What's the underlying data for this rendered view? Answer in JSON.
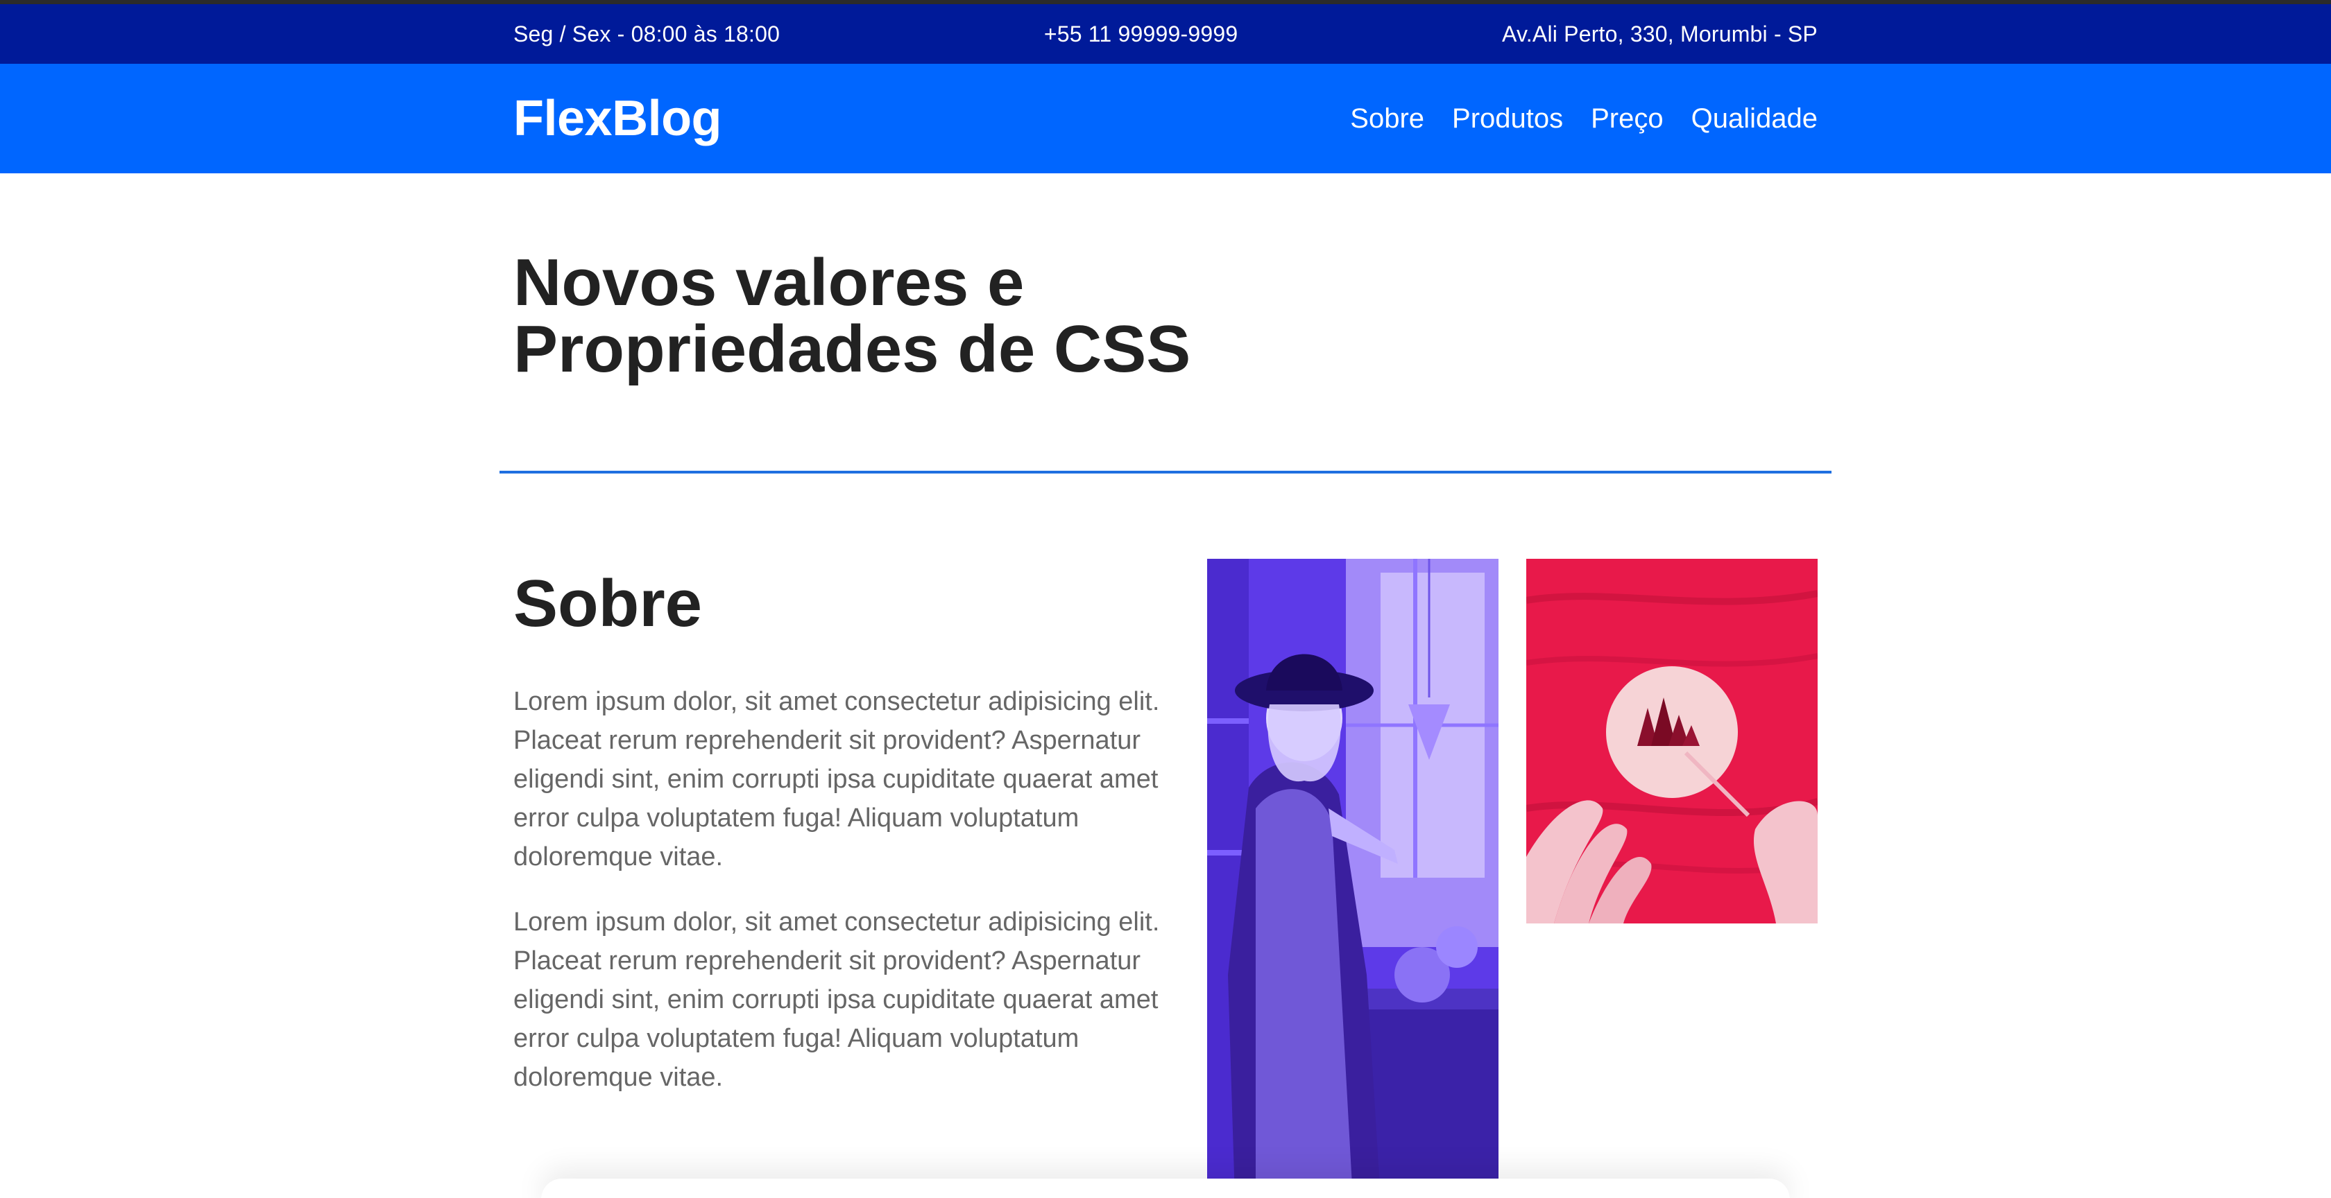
{
  "info_bar": {
    "hours": "Seg / Sex - 08:00 às 18:00",
    "phone": "+55 11 99999-9999",
    "address": "Av.Ali Perto, 330, Morumbi - SP"
  },
  "nav": {
    "logo": "FlexBlog",
    "links": [
      "Sobre",
      "Produtos",
      "Preço",
      "Qualidade"
    ]
  },
  "hero": {
    "title_line1": "Novos valores e",
    "title_line2": "Propriedades de CSS"
  },
  "about": {
    "title": "Sobre",
    "paragraphs": [
      "Lorem ipsum dolor, sit amet consectetur adipisicing elit. Placeat rerum reprehenderit sit provident? Aspernatur eligendi sint, enim corrupti ipsa cupiditate quaerat amet error culpa voluptatem fuga! Aliquam voluptatum doloremque vitae.",
      "Lorem ipsum dolor, sit amet consectetur adipisicing elit. Placeat rerum reprehenderit sit provident? Aspernatur eligendi sint, enim corrupti ipsa cupiditate quaerat amet error culpa voluptatem fuga! Aliquam voluptatum doloremque vitae."
    ]
  },
  "colors": {
    "info_bar": "#001a99",
    "nav_bar": "#0066ff",
    "divider": "#1f6fe0",
    "heading": "#222222",
    "body_text": "#666666",
    "image_purple": "#5b37e6",
    "image_red": "#e61c4a"
  }
}
